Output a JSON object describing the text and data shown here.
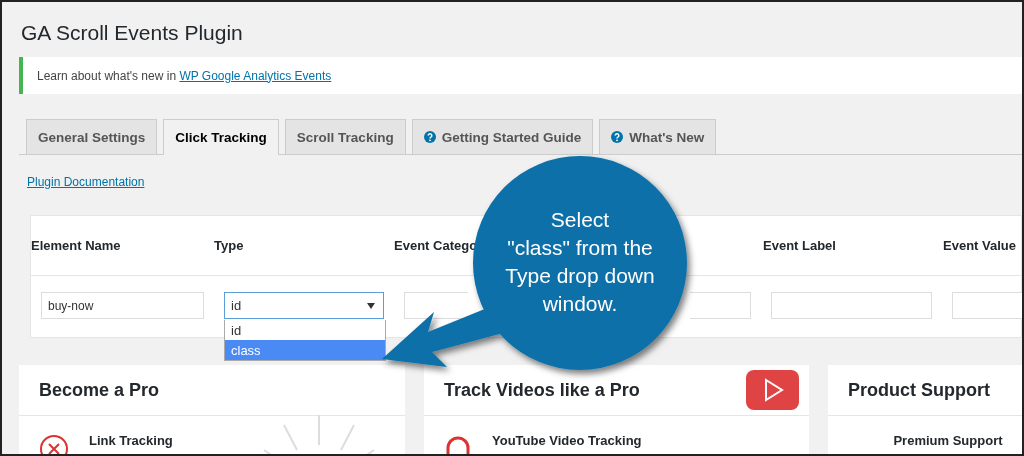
{
  "page_title": "GA Scroll Events Plugin",
  "notice": {
    "text": "Learn about what's new in ",
    "link": "WP Google Analytics Events"
  },
  "tabs": [
    {
      "label": "General Settings",
      "selected": false,
      "icon": false
    },
    {
      "label": "Click Tracking",
      "selected": true,
      "icon": false
    },
    {
      "label": "Scroll Tracking",
      "selected": false,
      "icon": false
    },
    {
      "label": "Getting Started Guide",
      "selected": false,
      "icon": true
    },
    {
      "label": "What's New",
      "selected": false,
      "icon": true
    }
  ],
  "doc_link": "Plugin Documentation",
  "table": {
    "columns": [
      {
        "label": "Element Name"
      },
      {
        "label": "Type"
      },
      {
        "label": "Event Catego"
      },
      {
        "label": "Event Label"
      },
      {
        "label": "Event Value"
      }
    ],
    "row": {
      "element_name": "buy-now",
      "type": "id"
    }
  },
  "dropdown": {
    "options": [
      {
        "label": "id",
        "selected": false
      },
      {
        "label": "class",
        "selected": true
      }
    ]
  },
  "cards": [
    {
      "title": "Become a Pro",
      "item": "Link Tracking",
      "kind": "pro"
    },
    {
      "title": "Track Videos like a Pro",
      "item": "YouTube Video Tracking",
      "kind": "video"
    },
    {
      "title": "Product Support",
      "item": "Premium Support",
      "kind": "support"
    }
  ],
  "callout": {
    "lines": [
      "Select",
      "\"class\" from the",
      "Type drop down",
      "window."
    ]
  }
}
